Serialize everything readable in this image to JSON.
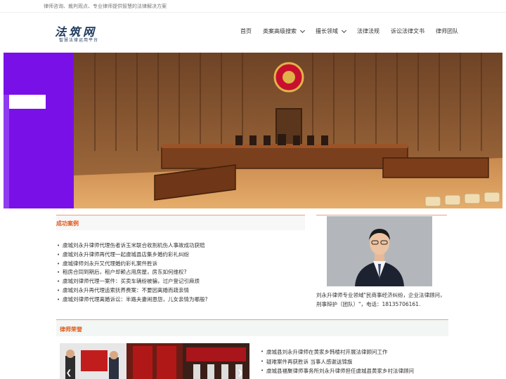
{
  "site": {
    "tagline": "律师咨询、裁判观点、专业律师提供智慧的法律解决方案",
    "logo_main": "法筑网",
    "logo_sub": "智慧法律运用平台"
  },
  "nav": {
    "items": [
      {
        "label": "首页",
        "has_dropdown": false
      },
      {
        "label": "类案高级搜索",
        "has_dropdown": true
      },
      {
        "label": "擅长领域",
        "has_dropdown": true
      },
      {
        "label": "法律法规",
        "has_dropdown": false
      },
      {
        "label": "诉讼法律文书",
        "has_dropdown": false
      },
      {
        "label": "律师团队",
        "has_dropdown": false
      }
    ]
  },
  "cases": {
    "title": "成功案例",
    "items": [
      "虞城刘永升律师代理伤者诉玉米联合收割机伤人事故成功获赔",
      "虞城刘永升律师再代理一起虞城县店集乡婚约彩礼纠纷",
      "虞城律师刘永升又代理婚约彩礼案件胜诉",
      "租房合同到期后，租户却赖占用房屋，房东如何维权?",
      "虞城刘律师代理一案件：买卖车辆纷被骗，过户登记引麻烦",
      "虞城刘永升再代理追索抚养费案：不要因离婚而疏亲情",
      "虞城刘律师代理离婚诉讼：半路夫妻闹恩怨，儿女亲情为哪般?"
    ]
  },
  "lawyer": {
    "description": "刘永升律师专业领域\"民商事经济纠纷，企业法律顾问，刑事辩护（团队）\"，电话：18135706161."
  },
  "honors": {
    "title": "律师荣誉",
    "items": [
      "虞城县刘永升律师在黄家乡韩楼村开展法律顾问工作",
      "疑难案件再获胜诉 当事人感谢送锦旗",
      "虞城县福聚律师事务所刘永升律师担任虞城县黄家乡村法律顾问"
    ],
    "prev_arrow": "❮",
    "next_arrow": "❯"
  },
  "colors": {
    "accent": "#e05a1a",
    "logo": "#1f3a5c",
    "hero_purple": "#7a10e8"
  }
}
